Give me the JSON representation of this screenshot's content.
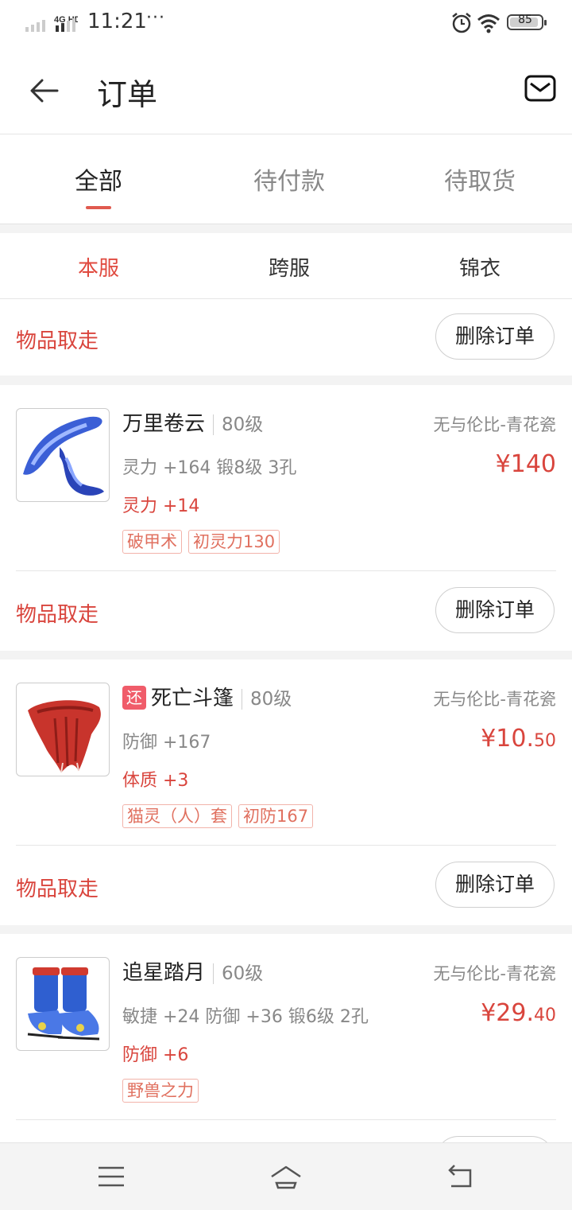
{
  "status_bar": {
    "network": "4G HD",
    "time": "11:21",
    "more": "···",
    "battery": "85"
  },
  "header": {
    "title": "订单"
  },
  "tabs": [
    {
      "label": "全部",
      "active": true
    },
    {
      "label": "待付款",
      "active": false
    },
    {
      "label": "待取货",
      "active": false
    }
  ],
  "subtabs": [
    {
      "label": "本服",
      "active": true
    },
    {
      "label": "跨服",
      "active": false
    },
    {
      "label": "锦衣",
      "active": false
    }
  ],
  "first_order": {
    "status": "物品取走",
    "delete_label": "删除订单"
  },
  "orders": [
    {
      "name": "万里卷云",
      "level": "80级",
      "attrs": "灵力 +164  锻8级  3孔",
      "extra": "灵力 +14",
      "tags": [
        "破甲术",
        "初灵力130"
      ],
      "server": "无与伦比-青花瓷",
      "price_main": "¥140",
      "price_cents": "",
      "status": "物品取走",
      "delete_label": "删除订单"
    },
    {
      "badge": "还",
      "name": "死亡斗篷",
      "level": "80级",
      "attrs": "防御 +167",
      "extra": "体质 +3",
      "tags": [
        "猫灵（人）套",
        "初防167"
      ],
      "server": "无与伦比-青花瓷",
      "price_main": "¥10.",
      "price_cents": "50",
      "status": "物品取走",
      "delete_label": "删除订单"
    },
    {
      "name": "追星踏月",
      "level": "60级",
      "attrs": "敏捷 +24 防御 +36  锻6级  2孔",
      "extra": "防御 +6",
      "tags": [
        "野兽之力"
      ],
      "server": "无与伦比-青花瓷",
      "price_main": "¥29.",
      "price_cents": "40"
    }
  ],
  "colors": {
    "accent": "#d9453d",
    "tag_border": "#f2b3aa",
    "badge": "#f05c6a"
  }
}
